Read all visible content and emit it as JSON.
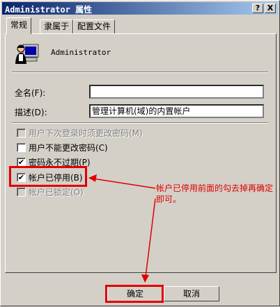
{
  "window": {
    "title": "Administrator 属性",
    "help_label": "?",
    "close_label": "X"
  },
  "tabs": [
    {
      "label": "常规",
      "active": true
    },
    {
      "label": "隶属于",
      "active": false
    },
    {
      "label": "配置文件",
      "active": false
    }
  ],
  "user": {
    "name": "Administrator"
  },
  "fields": {
    "fullname": {
      "label": "全名(F):",
      "value": ""
    },
    "description": {
      "label": "描述(D):",
      "value": "管理计算机(域)的内置帐户"
    }
  },
  "checkboxes": [
    {
      "label": "用户下次登录时须更改密码(M)",
      "checked": false,
      "disabled": true
    },
    {
      "label": "用户不能更改密码(C)",
      "checked": false,
      "disabled": false
    },
    {
      "label": "密码永不过期(P)",
      "checked": true,
      "disabled": false
    },
    {
      "label": "帐户已停用(B)",
      "checked": true,
      "disabled": false
    },
    {
      "label": "帐户已锁定(O)",
      "checked": false,
      "disabled": true
    }
  ],
  "checkmark": "✔",
  "annotation": {
    "text": "帐户已停用前面的勾去掉再确定即可。"
  },
  "buttons": {
    "ok": "确定",
    "cancel": "取消"
  },
  "colors": {
    "annotation": "#e00000",
    "titlebar": "#0a246a"
  }
}
